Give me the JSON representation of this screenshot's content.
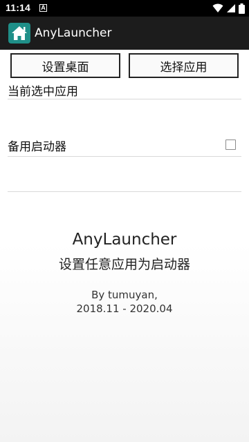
{
  "status_bar": {
    "time": "11:14",
    "notification_glyph": "A",
    "icons": [
      "wifi-icon",
      "signal-icon",
      "battery-icon"
    ]
  },
  "app_bar": {
    "title": "AnyLauncher",
    "icon": "home-launcher-icon",
    "icon_color": "#1f8f88"
  },
  "buttons": {
    "set_desktop": "设置桌面",
    "select_app": "选择应用"
  },
  "rows": {
    "current_app_label": "当前选中应用",
    "backup_launcher_label": "备用启动器",
    "backup_launcher_checked": false
  },
  "about": {
    "app_name": "AnyLauncher",
    "tagline": "设置任意应用为启动器",
    "author": "By tumuyan,",
    "date_range": "2018.11 - 2020.04"
  }
}
